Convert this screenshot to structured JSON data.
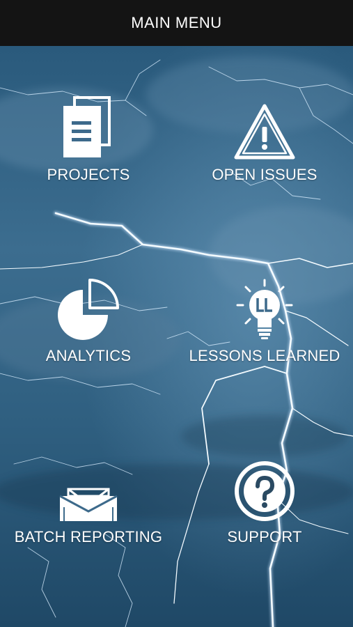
{
  "header": {
    "title": "MAIN MENU"
  },
  "menu": {
    "items": [
      {
        "label": "PROJECTS",
        "icon": "documents-icon"
      },
      {
        "label": "OPEN ISSUES",
        "icon": "warning-icon"
      },
      {
        "label": "ANALYTICS",
        "icon": "pie-chart-icon"
      },
      {
        "label": "LESSONS LEARNED",
        "icon": "lightbulb-icon"
      },
      {
        "label": "BATCH REPORTING",
        "icon": "envelope-icon"
      },
      {
        "label": "SUPPORT",
        "icon": "help-icon"
      }
    ]
  },
  "colors": {
    "header_bg": "#141414",
    "sky_dark": "#0f2f47",
    "sky_light": "#4f7f9f",
    "text": "#ffffff"
  }
}
